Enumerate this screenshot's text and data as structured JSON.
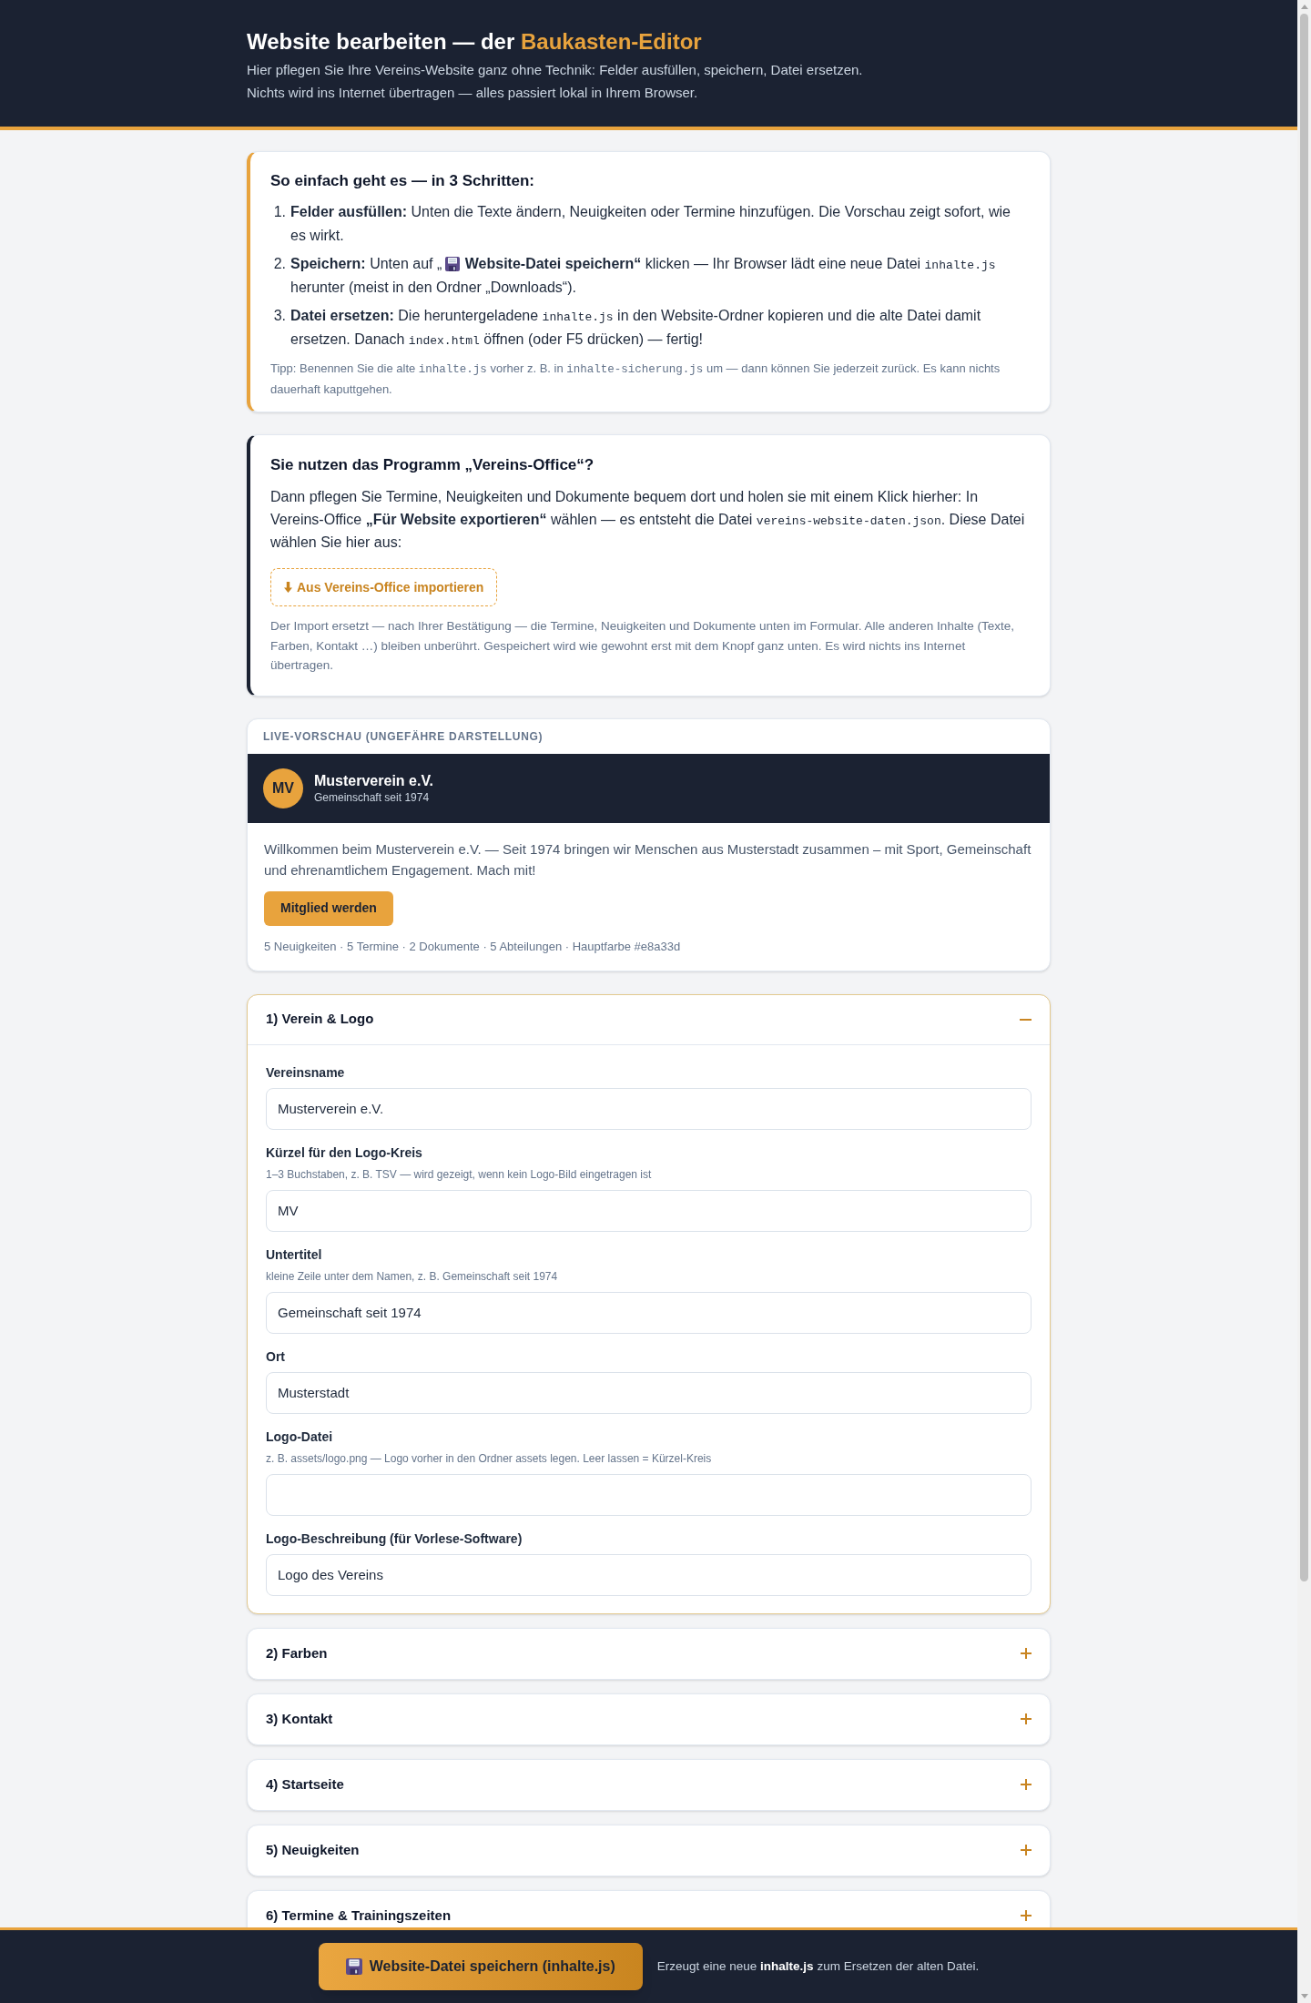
{
  "header": {
    "title": "Website bearbeiten — der",
    "title_highlight": "Baukasten-Editor",
    "subtitle_lines": [
      "Hier pflegen Sie Ihre Vereins-Website ganz ohne Technik: Felder ausfüllen, speichern, Datei ersetzen.",
      "Nichts wird ins Internet übertragen — alles passiert lokal in Ihrem Browser."
    ]
  },
  "steps_card": {
    "title": "So einfach geht es — in 3 Schritten:",
    "steps": [
      {
        "number": "1.",
        "segments": [
          {
            "kind": "text",
            "text": "**Felder ausfüllen:** Unten die Texte ändern, Neuigkeiten oder Termine hinzufügen. Die Vorschau zeigt sofort, wie es wirkt."
          }
        ]
      },
      {
        "number": "2.",
        "segments": [
          {
            "kind": "text",
            "text": "**Speichern:** Unten auf „"
          },
          {
            "kind": "icon"
          },
          {
            "kind": "text",
            "text": " **Website-Datei speichern“** klicken — Ihr Browser lädt eine neue Datei "
          },
          {
            "kind": "code",
            "text": "inhalte.js"
          },
          {
            "kind": "text",
            "text": " herunter (meist in den Ordner „Downloads“)."
          }
        ]
      },
      {
        "number": "3.",
        "segments": [
          {
            "kind": "text",
            "text": "**Datei ersetzen:** Die heruntergeladene "
          },
          {
            "kind": "code",
            "text": "inhalte.js"
          },
          {
            "kind": "text",
            "text": " in den Website-Ordner kopieren und die alte Datei damit ersetzen. Danach "
          },
          {
            "kind": "code",
            "text": "index.html"
          },
          {
            "kind": "text",
            "text": " öffnen (oder F5 drücken) — fertig!"
          }
        ]
      }
    ],
    "tip": [
      {
        "kind": "text",
        "text": "Tipp: Benennen Sie die alte "
      },
      {
        "kind": "code",
        "text": "inhalte.js"
      },
      {
        "kind": "text",
        "text": " vorher z. B. in "
      },
      {
        "kind": "code",
        "text": "inhalte-sicherung.js"
      },
      {
        "kind": "text",
        "text": " um — dann können Sie jederzeit zurück. Es kann nichts dauerhaft kaputtgehen."
      }
    ]
  },
  "import_card": {
    "title": "Sie nutzen das Programm „Vereins-Office“?",
    "body": [
      {
        "kind": "text",
        "text": "Dann pflegen Sie Termine, Neuigkeiten und Dokumente bequem dort und holen sie mit einem Klick hierher: In Vereins-Office **„Für Website exportieren“** wählen — es entsteht die Datei "
      },
      {
        "kind": "code",
        "text": "vereins-website-daten.json"
      },
      {
        "kind": "text",
        "text": ". Diese Datei wählen Sie hier aus:"
      }
    ],
    "import_button": "Aus Vereins-Office importieren",
    "note": "Der Import ersetzt — nach Ihrer Bestätigung — die Termine, Neuigkeiten und Dokumente unten im Formular. Alle anderen Inhalte (Texte, Farben, Kontakt …) bleiben unberührt. Gespeichert wird wie gewohnt erst mit dem Knopf ganz unten. Es wird nichts ins Internet übertragen."
  },
  "preview": {
    "label": "LIVE-VORSCHAU (UNGEFÄHRE DARSTELLUNG)",
    "logo_initials": "MV",
    "club_name": "Musterverein e.V.",
    "club_subtitle": "Gemeinschaft seit 1974",
    "welcome_text": "Willkommen beim Musterverein e.V. — Seit 1974 bringen wir Menschen aus Musterstadt zusammen – mit Sport, Gemeinschaft und ehrenamtlichem Engagement. Mach mit!",
    "cta_button": "Mitglied werden",
    "stats": "5 Neuigkeiten · 5 Termine · 2 Dokumente · 5 Abteilungen · Hauptfarbe #e8a33d"
  },
  "sections": [
    {
      "title": "1) Verein & Logo",
      "expanded": true,
      "fields": [
        {
          "label": "Vereinsname",
          "value": "Musterverein e.V."
        },
        {
          "label": "Kürzel für den Logo-Kreis",
          "hint": "1–3 Buchstaben, z. B. TSV — wird gezeigt, wenn kein Logo-Bild eingetragen ist",
          "value": "MV"
        },
        {
          "label": "Untertitel",
          "hint": "kleine Zeile unter dem Namen, z. B. Gemeinschaft seit 1974",
          "value": "Gemeinschaft seit 1974"
        },
        {
          "label": "Ort",
          "value": "Musterstadt"
        },
        {
          "label": "Logo-Datei",
          "hint": "z. B. assets/logo.png — Logo vorher in den Ordner assets legen. Leer lassen = Kürzel-Kreis"
        },
        {
          "label": "Logo-Beschreibung (für Vorlese-Software)",
          "value": "Logo des Vereins"
        }
      ]
    },
    {
      "title": "2) Farben",
      "expanded": false
    },
    {
      "title": "3) Kontakt",
      "expanded": false
    },
    {
      "title": "4) Startseite",
      "expanded": false
    },
    {
      "title": "5) Neuigkeiten",
      "expanded": false
    },
    {
      "title": "6) Termine & Trainingszeiten",
      "expanded": false
    }
  ],
  "save_bar": {
    "button": "Website-Datei speichern (inhalte.js)",
    "note": "Erzeugt eine neue **inhalte.js** zum Ersetzen der alten Datei."
  }
}
